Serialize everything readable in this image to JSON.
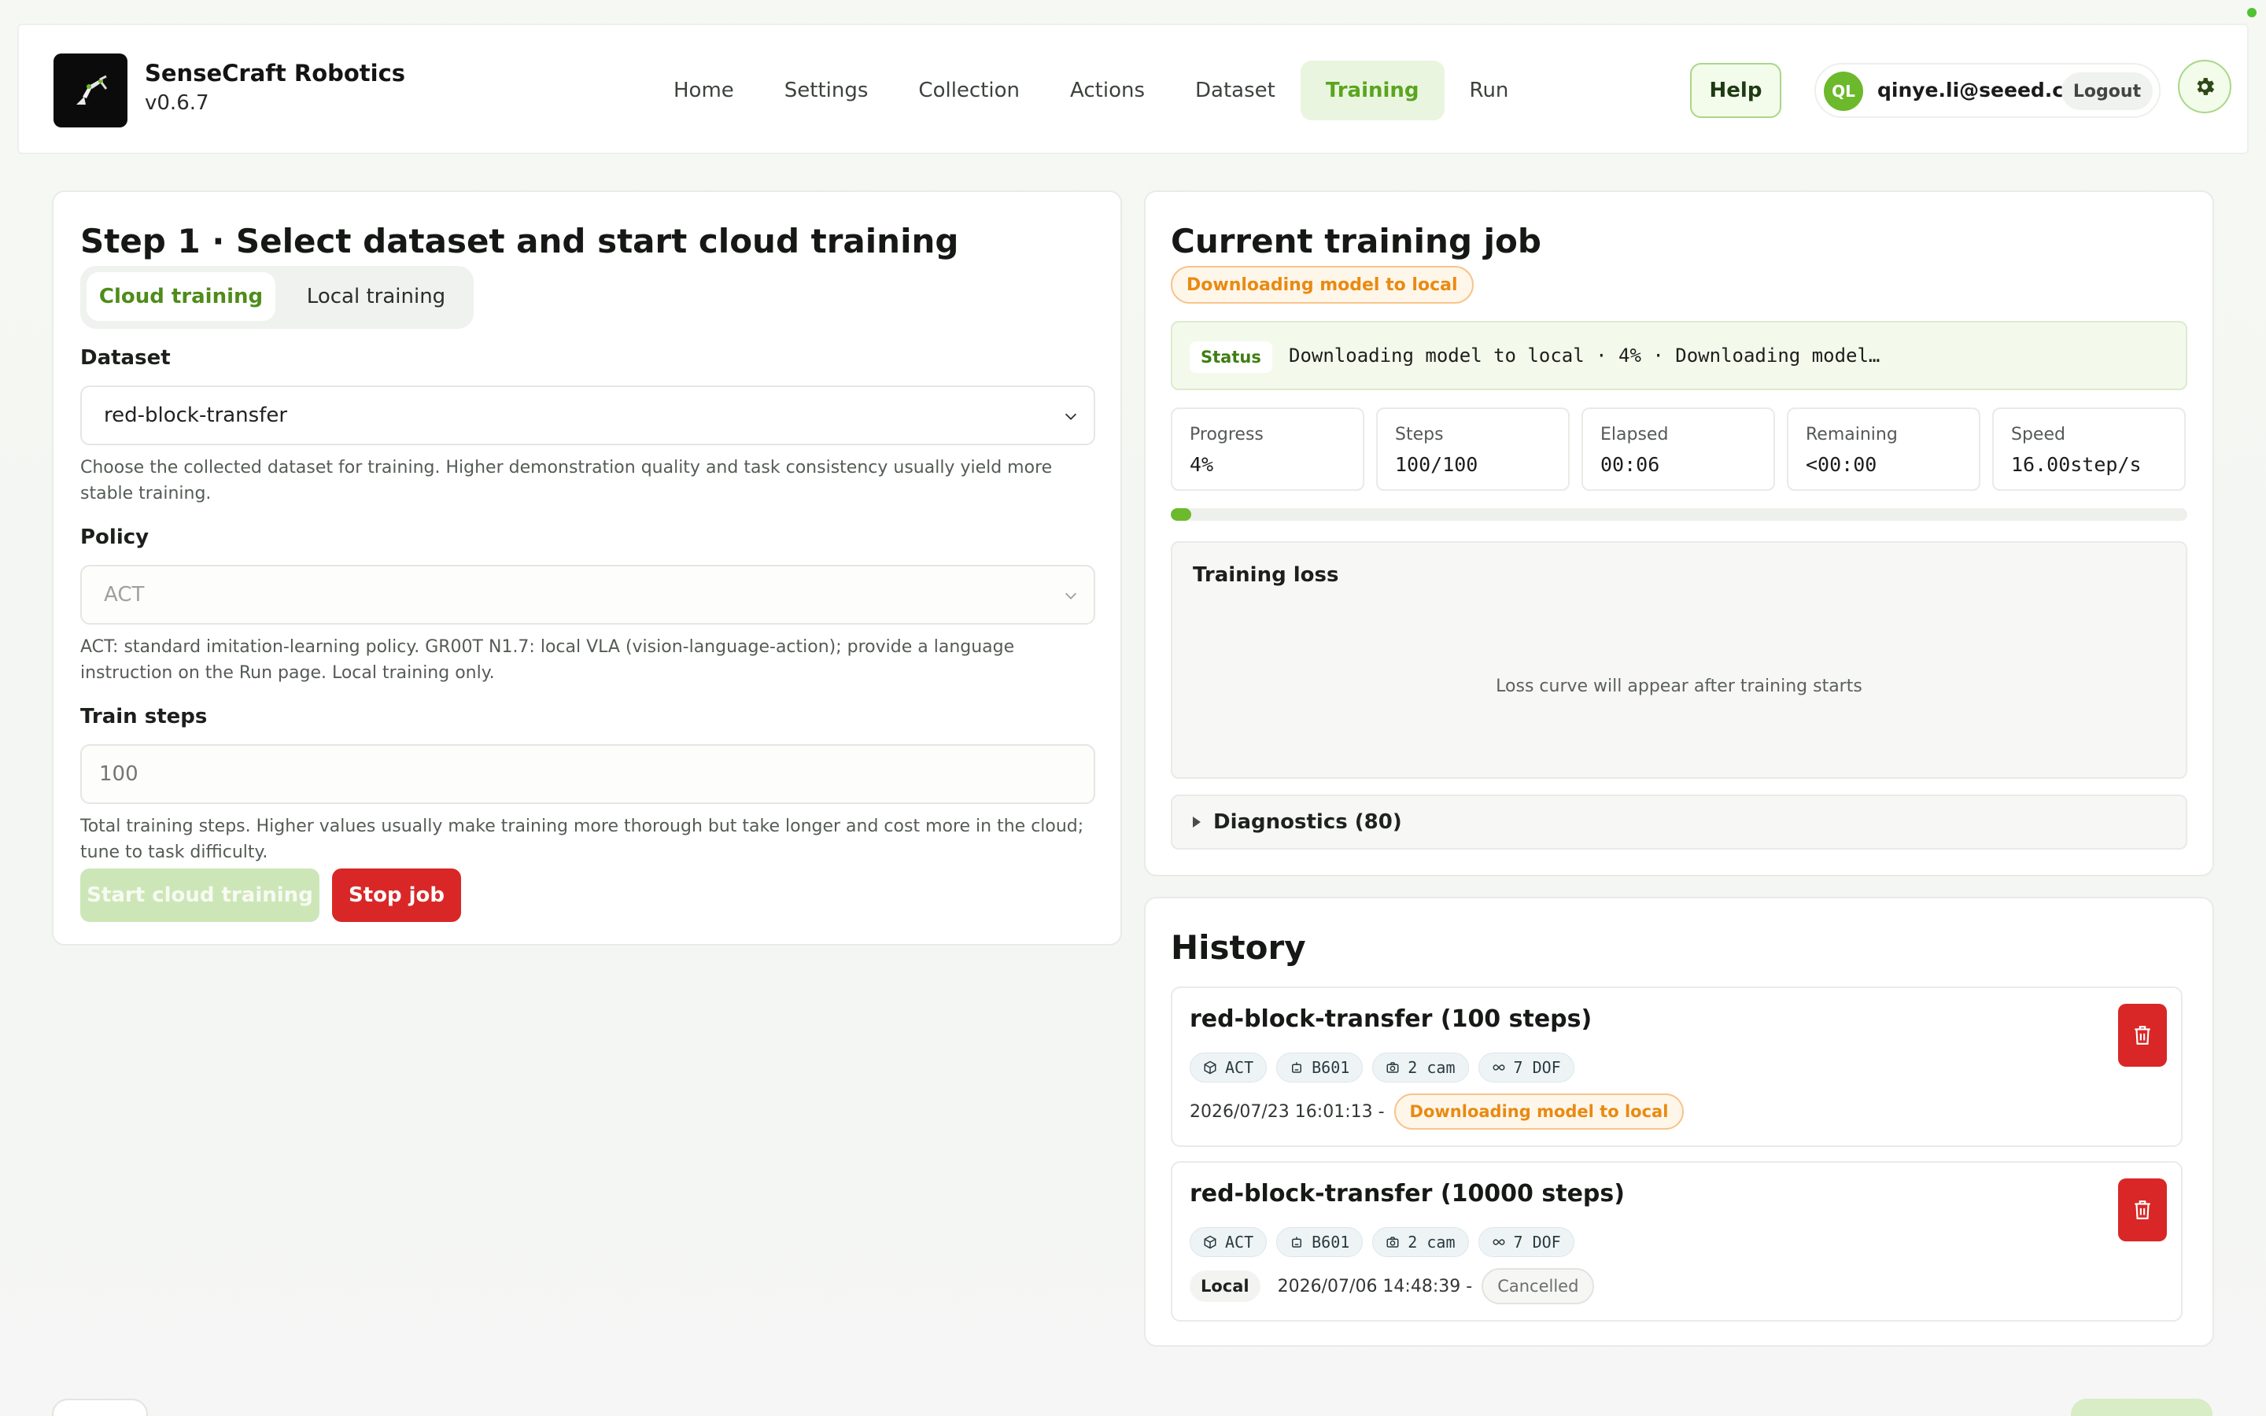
{
  "app": {
    "name": "SenseCraft Robotics",
    "version": "v0.6.7"
  },
  "nav": {
    "items": [
      {
        "label": "Home",
        "active": false
      },
      {
        "label": "Settings",
        "active": false
      },
      {
        "label": "Collection",
        "active": false
      },
      {
        "label": "Actions",
        "active": false
      },
      {
        "label": "Dataset",
        "active": false
      },
      {
        "label": "Training",
        "active": true
      },
      {
        "label": "Run",
        "active": false
      }
    ]
  },
  "header": {
    "help_label": "Help",
    "user": {
      "initials": "QL",
      "email": "qinye.li@seeed.cc"
    },
    "logout_label": "Logout",
    "settings_icon": "gear-icon"
  },
  "step1": {
    "title": "Step 1 · Select dataset and start cloud training",
    "tabs": {
      "cloud": "Cloud training",
      "local": "Local training",
      "selected": "cloud"
    },
    "dataset": {
      "label": "Dataset",
      "value": "red-block-transfer",
      "hint": "Choose the collected dataset for training. Higher demonstration quality and task consistency usually yield more stable training."
    },
    "policy": {
      "label": "Policy",
      "value": "ACT",
      "hint": "ACT: standard imitation-learning policy. GR00T N1.7: local VLA (vision-language-action); provide a language instruction on the Run page. Local training only."
    },
    "train_steps": {
      "label": "Train steps",
      "placeholder": "100",
      "hint": "Total training steps. Higher values usually make training more thorough but take longer and cost more in the cloud; tune to task difficulty."
    },
    "start_label": "Start cloud training",
    "stop_label": "Stop job"
  },
  "current_job": {
    "title": "Current training job",
    "badge": "Downloading model to local",
    "status_label": "Status",
    "status_text": "Downloading model to local · 4% · Downloading model…",
    "stats": [
      {
        "label": "Progress",
        "value": "4%"
      },
      {
        "label": "Steps",
        "value": "100/100"
      },
      {
        "label": "Elapsed",
        "value": "00:06"
      },
      {
        "label": "Remaining",
        "value": "<00:00"
      },
      {
        "label": "Speed",
        "value": "16.00step/s"
      }
    ],
    "progress_fraction": 0.02,
    "loss": {
      "title": "Training loss",
      "empty_text": "Loss curve will appear after training starts"
    },
    "diagnostics_label": "Diagnostics (80)"
  },
  "history": {
    "title": "History",
    "items": [
      {
        "title": "red-block-transfer (100 steps)",
        "chips": [
          "ACT",
          "B601",
          "2 cam",
          "7 DOF"
        ],
        "local": "",
        "date": "2026/07/23 16:01:13 -",
        "status": "Downloading model to local"
      },
      {
        "title": "red-block-transfer (10000 steps)",
        "chips": [
          "ACT",
          "B601",
          "2 cam",
          "7 DOF"
        ],
        "local": "Local",
        "date": "2026/07/06 14:48:39 -",
        "status": "Cancelled"
      }
    ]
  },
  "colors": {
    "accent": "#6cb92c",
    "accent_bg": "#eaf5df",
    "danger": "#d92727",
    "warning": "#e98a11"
  }
}
